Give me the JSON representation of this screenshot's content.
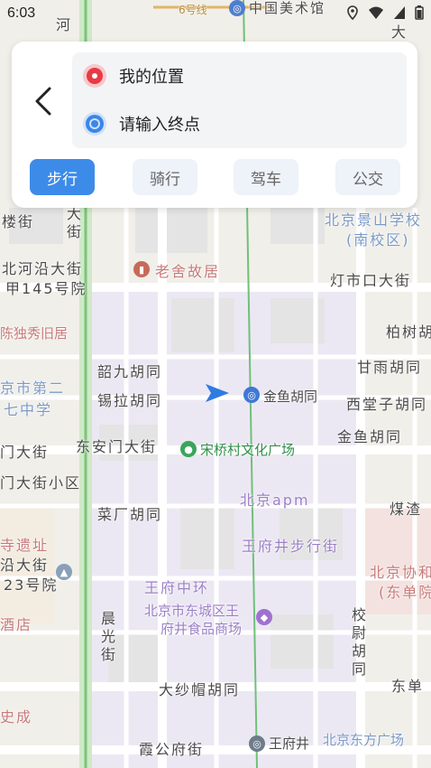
{
  "status_bar": {
    "time": "6:03"
  },
  "route": {
    "start_label": "我的位置",
    "end_placeholder": "请输入终点"
  },
  "tabs": [
    {
      "label": "步行",
      "active": true
    },
    {
      "label": "骑行",
      "active": false
    },
    {
      "label": "驾车",
      "active": false
    },
    {
      "label": "公交",
      "active": false
    }
  ],
  "map_labels": {
    "top_subway": "6号线",
    "top_museum": "中国美术馆",
    "river_top": "河",
    "da": "大",
    "lou_jie": "楼街",
    "da_jie_vert": "大街",
    "bei_he_yan": "北河沿大街",
    "jia145": "甲145号院",
    "laoshe": "老舍故居",
    "chenduxiu": "陈独秀旧居",
    "jingshan": "北京景山学校",
    "jingshan_sub": "(南校区)",
    "dengshikou": "灯市口大街",
    "baishu": "柏树胡",
    "ganyu": "甘雨胡同",
    "xitangzi": "西堂子胡同",
    "shaojiu": "韶九胡同",
    "xila": "锡拉胡同",
    "jinyu_poi": "金鱼胡同",
    "jinyu_st": "金鱼胡同",
    "school_a": "京市第二",
    "school_b": "七中学",
    "menda": "门大街",
    "donganmen": "东安门大街",
    "songqiao": "宋桥村文化广场",
    "dajie_xiaoqu": "门大街小区",
    "caichang": "菜厂胡同",
    "bjapm": "北京apm",
    "meizha": "煤渣",
    "ruins": "寺遗址",
    "yan_dajie": "沿大街",
    "no23": "23号院",
    "wangfujing_walk": "王府井步行街",
    "xiehe": "北京协和",
    "dongdan": "(东单院",
    "wangfu_ring": "王府中环",
    "foodmall_a": "北京市东城区王",
    "foodmall_b": "府井食品商场",
    "jiudian": "酒店",
    "chenguang": "晨光街",
    "xiaowei": "校尉胡同",
    "dashamao": "大纱帽胡同",
    "dongdan_st": "东单",
    "shicheng": "史成",
    "xiagongfu": "霞公府街",
    "wangfujing_stn": "王府井",
    "dongfang": "北京东方广场"
  }
}
